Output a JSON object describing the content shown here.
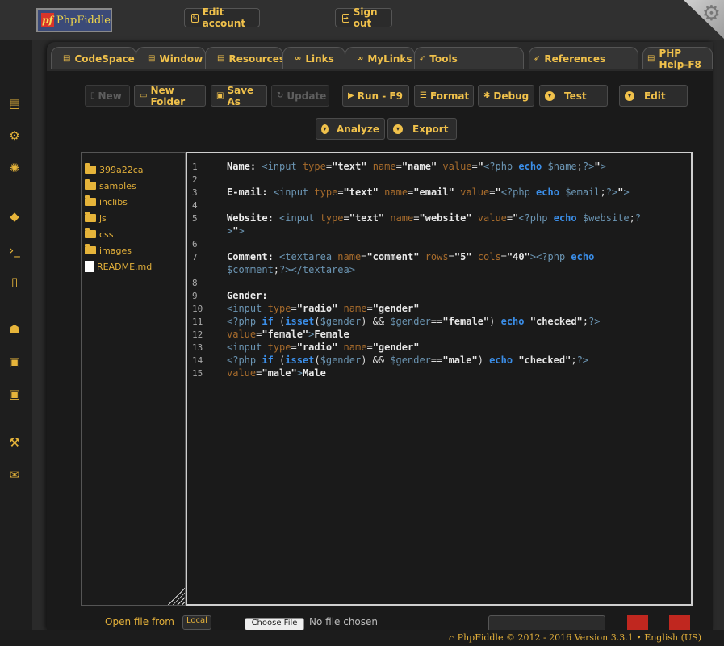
{
  "header": {
    "logo_mark": "pf",
    "logo_text": "PhpFiddle",
    "edit_account": "Edit account",
    "sign_out": "Sign out"
  },
  "tabs": [
    {
      "label": "CodeSpace",
      "icon": "file-icon"
    },
    {
      "label": "Window",
      "icon": "file-icon"
    },
    {
      "label": "Resources",
      "icon": "file-icon"
    },
    {
      "label": "Links",
      "icon": "link-icon"
    },
    {
      "label": "MyLinks",
      "icon": "link-icon"
    },
    {
      "label": "Tools",
      "icon": "rocket-icon"
    },
    {
      "label": "References",
      "icon": "rocket-icon"
    },
    {
      "label": "PHP Help-F8",
      "icon": "book-icon"
    }
  ],
  "toolbar": {
    "new": "New",
    "new_folder": "New Folder",
    "save_as": "Save As",
    "update": "Update",
    "run": "Run - F9",
    "format": "Format",
    "debug": "Debug",
    "test": "Test",
    "edit": "Edit",
    "analyze": "Analyze",
    "export": "Export"
  },
  "files": [
    {
      "name": "399a22ca",
      "type": "folder"
    },
    {
      "name": "samples",
      "type": "folder"
    },
    {
      "name": "inclibs",
      "type": "folder"
    },
    {
      "name": "js",
      "type": "folder"
    },
    {
      "name": "css",
      "type": "folder"
    },
    {
      "name": "images",
      "type": "folder"
    },
    {
      "name": "README.md",
      "type": "file"
    }
  ],
  "editor": {
    "line_numbers": [
      "1",
      "2",
      "3",
      "4",
      "5",
      "6",
      "7",
      "8",
      "9",
      "10",
      "11",
      "12",
      "13",
      "14",
      "15"
    ]
  },
  "bottom": {
    "open_file": "Open file from",
    "local": "Local",
    "choose_file": "Choose File",
    "no_file": "No file chosen"
  },
  "footer": {
    "text": "PhpFiddle © 2012 - 2016 Version 3.3.1 • English (US)"
  },
  "colors": {
    "accent": "#f0c14b",
    "background": "#1a1a1a",
    "keyword": "#3b8ee8"
  }
}
